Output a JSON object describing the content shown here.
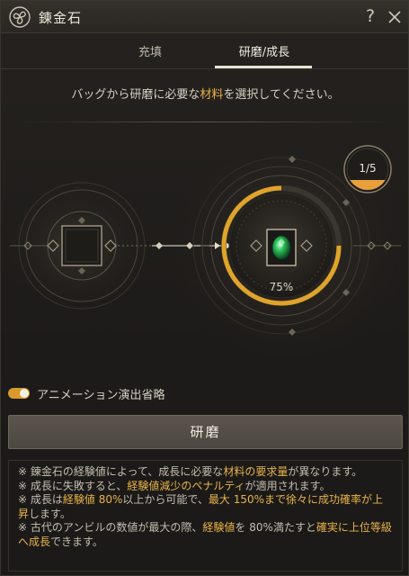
{
  "window": {
    "title": "錬金石",
    "help_label": "?"
  },
  "tabs": [
    {
      "label": "充填",
      "active": false
    },
    {
      "label": "研磨/成長",
      "active": true
    }
  ],
  "instruction": {
    "prefix": "バッグから研磨に必要な",
    "highlight": "材料",
    "suffix": "を選択してください。"
  },
  "target": {
    "progress_label": "75%",
    "progress": 0.75,
    "level_label": "1/5"
  },
  "animation_toggle": {
    "label": "アニメーション演出省略",
    "on": true
  },
  "polish_button": {
    "label": "研磨"
  },
  "notes": [
    {
      "segments": [
        {
          "t": "※ 錬金石の経験値によって、成長に必要な"
        },
        {
          "t": "材料の要求量",
          "hl": true
        },
        {
          "t": "が異なります。"
        }
      ]
    },
    {
      "segments": [
        {
          "t": "※ 成長に失敗すると、"
        },
        {
          "t": "経験値減少のペナルティ",
          "hl": true
        },
        {
          "t": "が適用されます。"
        }
      ]
    },
    {
      "segments": [
        {
          "t": "※ 成長は"
        },
        {
          "t": "経験値 80%",
          "hl": true
        },
        {
          "t": "以上から可能で、"
        },
        {
          "t": "最大 150%まで徐々に成功確率が上昇",
          "hl": true
        },
        {
          "t": "します。"
        }
      ]
    },
    {
      "segments": [
        {
          "t": "※ 古代のアンビルの数値が最大の際、"
        },
        {
          "t": "経験値",
          "hl": true
        },
        {
          "t": "を 80%満たすと"
        },
        {
          "t": "確実に上位等級へ成長",
          "hl": true
        },
        {
          "t": "できます。"
        }
      ]
    }
  ],
  "colors": {
    "accent": "#e8b24a",
    "progress_ring": "#e0a42a",
    "gem": "#2fbf5a"
  }
}
